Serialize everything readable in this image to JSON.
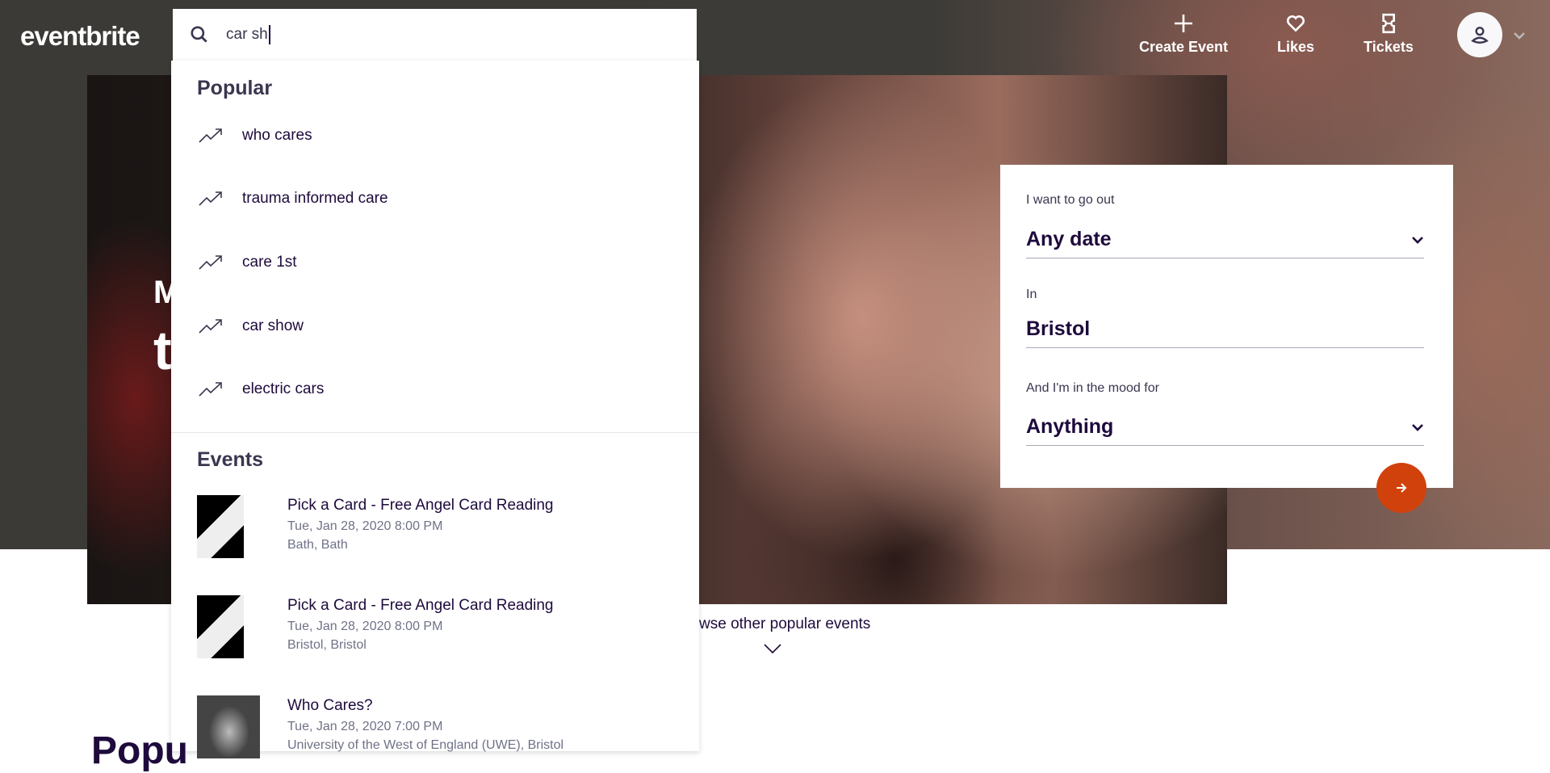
{
  "header": {
    "logo": "eventbrite",
    "search_value": "car sh",
    "nav": [
      {
        "label": "Create Event",
        "icon": "plus-icon"
      },
      {
        "label": "Likes",
        "icon": "heart-icon"
      },
      {
        "label": "Tickets",
        "icon": "ticket-icon"
      }
    ]
  },
  "dropdown": {
    "popular_heading": "Popular",
    "popular": [
      "who cares",
      "trauma informed care",
      "care 1st",
      "car show",
      "electric cars"
    ],
    "events_heading": "Events",
    "events": [
      {
        "title": "Pick a Card - Free Angel Card Reading",
        "date": "Tue, Jan 28, 2020 8:00 PM",
        "location": "Bath, Bath"
      },
      {
        "title": "Pick a Card - Free Angel Card Reading",
        "date": "Tue, Jan 28, 2020 8:00 PM",
        "location": "Bristol, Bristol"
      },
      {
        "title": "Who Cares?",
        "date": "Tue, Jan 28, 2020 7:00 PM",
        "location": "University of the West of England (UWE), Bristol"
      }
    ]
  },
  "hero": {
    "line1": "M",
    "line2": "t"
  },
  "panel": {
    "date_label": "I want to go out",
    "date_value": "Any date",
    "location_label": "In",
    "location_value": "Bristol",
    "mood_label": "And I'm in the mood for",
    "mood_value": "Anything"
  },
  "browse": "wse other popular events",
  "section_heading": "Popu",
  "colors": {
    "accent": "#d1410c",
    "header_bg": "#3b3a36"
  }
}
